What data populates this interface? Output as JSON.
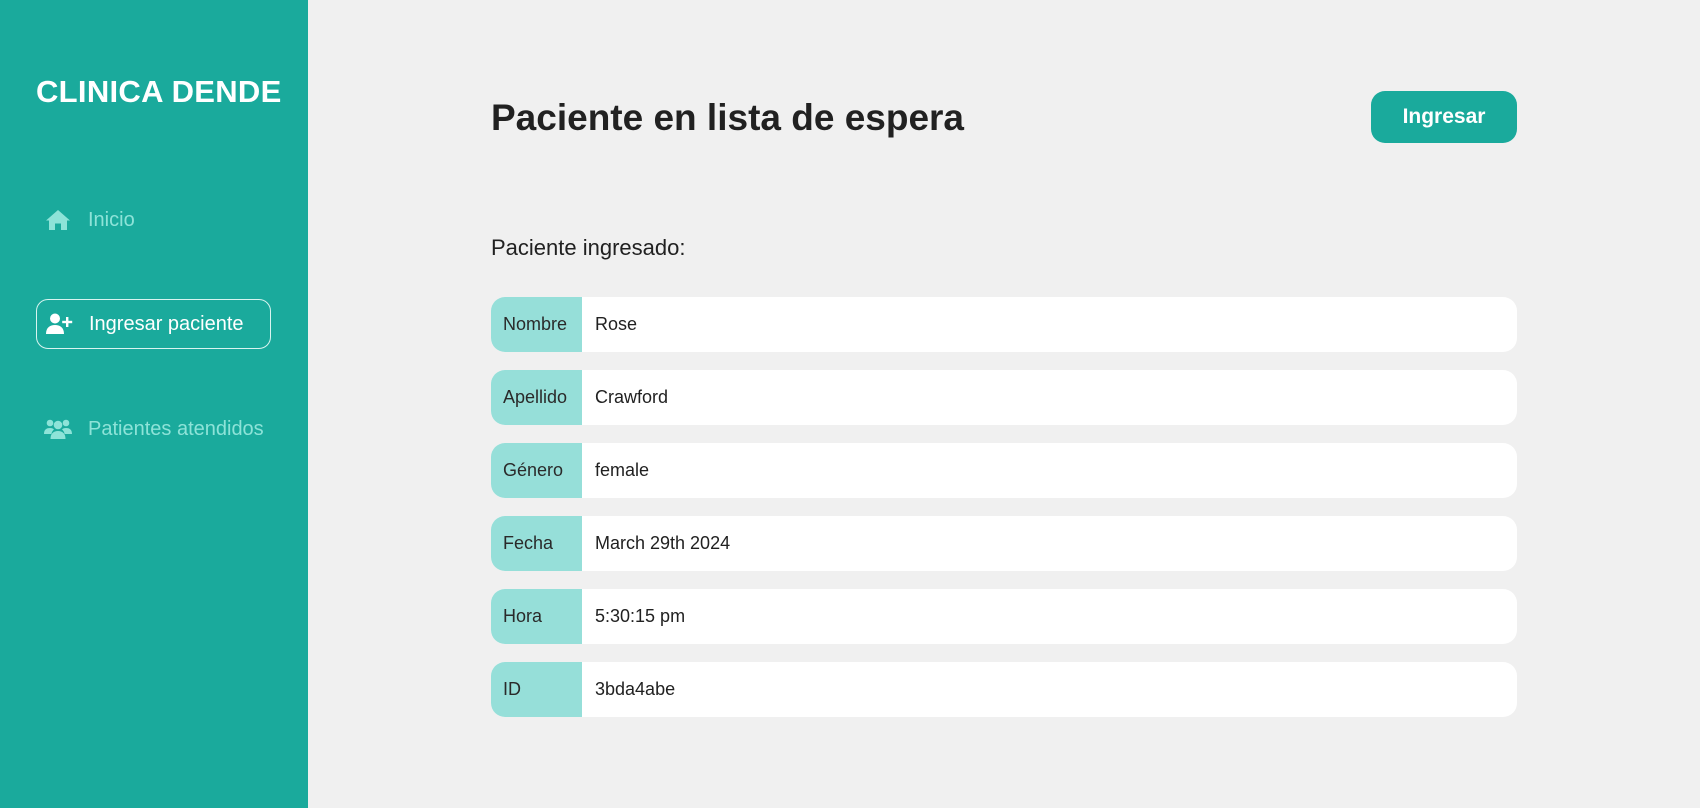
{
  "sidebar": {
    "brand": "CLINICA DENDE",
    "items": [
      {
        "label": "Inicio",
        "icon": "home-icon",
        "active": false
      },
      {
        "label": "Ingresar paciente",
        "icon": "user-plus-icon",
        "active": true
      },
      {
        "label": "Patientes atendidos",
        "icon": "users-icon",
        "active": false
      }
    ]
  },
  "main": {
    "title": "Paciente en lista de espera",
    "primary_button": "Ingresar",
    "section_label": "Paciente ingresado:",
    "fields": [
      {
        "key": "Nombre",
        "value": "Rose"
      },
      {
        "key": "Apellido",
        "value": "Crawford"
      },
      {
        "key": "Género",
        "value": "female"
      },
      {
        "key": "Fecha",
        "value": "March 29th 2024"
      },
      {
        "key": "Hora",
        "value": "5:30:15 pm"
      },
      {
        "key": "ID",
        "value": "3bda4abe"
      }
    ]
  },
  "colors": {
    "accent": "#1aaa9c",
    "field_key_bg": "#96dfd9",
    "background": "#f0f0f0",
    "muted_nav": "#8de3d8"
  }
}
